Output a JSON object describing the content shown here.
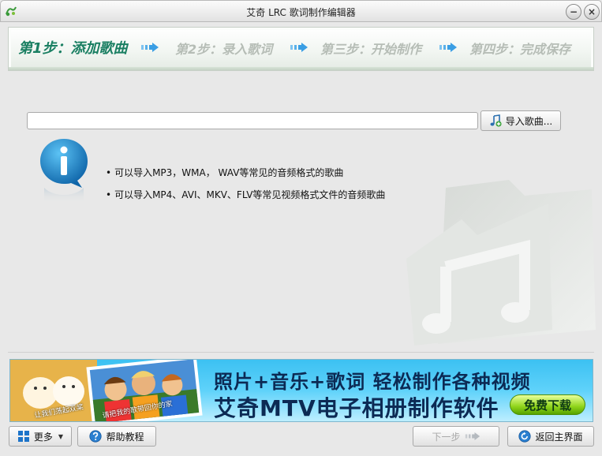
{
  "window": {
    "title": "艾奇 LRC 歌词制作编辑器",
    "minimize_glyph": "−",
    "close_glyph": "×",
    "logo_icon": "lrc-app-icon"
  },
  "steps": [
    {
      "label": "第1步：添加歌曲",
      "state": "active"
    },
    {
      "label": "第2步：录入歌词",
      "state": "inactive"
    },
    {
      "label": "第三步：开始制作",
      "state": "inactive"
    },
    {
      "label": "第四步：完成保存",
      "state": "inactive"
    }
  ],
  "import": {
    "path_value": "",
    "button_label": "导入歌曲..."
  },
  "tips": [
    "可以导入MP3，WMA， WAV等常见的音频格式的歌曲",
    "可以导入MP4、AVI、MKV、FLV等常见视频格式文件的音频歌曲"
  ],
  "ad": {
    "line1": "照片+音乐+歌词 轻松制作各种视频",
    "line2": "艾奇MTV电子相册制作软件",
    "download_label": "免费下载",
    "caption1": "让我们荡起双桨",
    "caption2": "请把我的歌带回你的家"
  },
  "footer": {
    "more_label": "更多",
    "help_label": "帮助教程",
    "next_label": "下一步",
    "home_label": "返回主界面"
  },
  "colors": {
    "active_step": "#1a7f62",
    "inactive_step": "#b6bdb6",
    "window_bg": "#e8e8e8",
    "ad_bg": "#3cc1f2"
  }
}
